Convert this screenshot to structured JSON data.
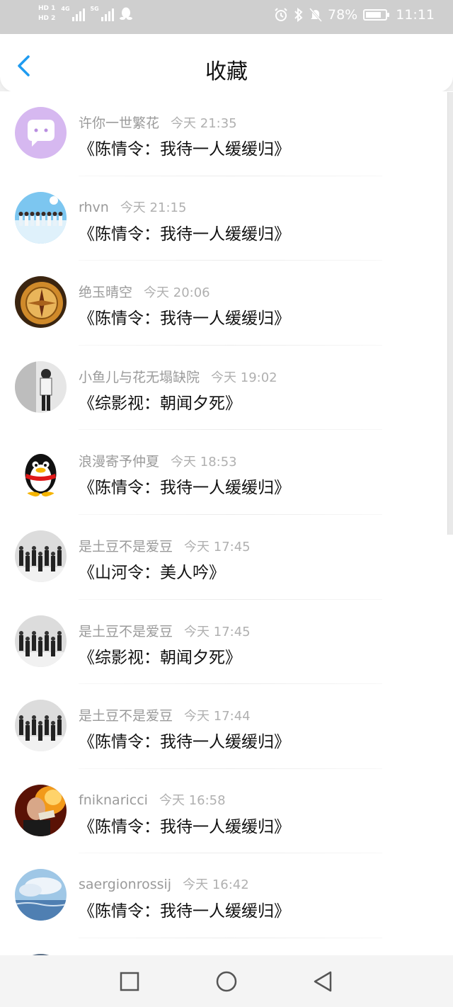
{
  "status_bar": {
    "hd1": "HD 1",
    "hd2": "HD 2",
    "net1": "4G",
    "net2": "5G",
    "battery_percent": "78%",
    "time": "11:11",
    "battery_level": 0.78
  },
  "header": {
    "title": "收藏",
    "accent": "#1e9bf0"
  },
  "favorites": [
    {
      "user": "许你一世繁花",
      "time": "今天 21:35",
      "title": "《陈情令：我待一人缓缓归》",
      "avatar": "chat-bubble"
    },
    {
      "user": "rhvn",
      "time": "今天 21:15",
      "title": "《陈情令：我待一人缓缓归》",
      "avatar": "group-sky"
    },
    {
      "user": "绝玉晴空",
      "time": "今天 20:06",
      "title": "《陈情令：我待一人缓缓归》",
      "avatar": "compass"
    },
    {
      "user": "小鱼儿与花无塌缺院",
      "time": "今天 19:02",
      "title": "《综影视：朝闻夕死》",
      "avatar": "person-bw"
    },
    {
      "user": "浪漫寄予仲夏",
      "time": "今天 18:53",
      "title": "《陈情令：我待一人缓缓归》",
      "avatar": "qq-penguin"
    },
    {
      "user": "是土豆不是爱豆",
      "time": "今天 17:45",
      "title": "《山河令：美人吟》",
      "avatar": "group-bw"
    },
    {
      "user": "是土豆不是爱豆",
      "time": "今天 17:45",
      "title": "《综影视：朝闻夕死》",
      "avatar": "group-bw"
    },
    {
      "user": "是土豆不是爱豆",
      "time": "今天 17:44",
      "title": "《陈情令：我待一人缓缓归》",
      "avatar": "group-bw"
    },
    {
      "user": "fniknaricci",
      "time": "今天 16:58",
      "title": "《陈情令：我待一人缓缓归》",
      "avatar": "fire-portrait"
    },
    {
      "user": "saergionrossij",
      "time": "今天 16:42",
      "title": "《陈情令：我待一人缓缓归》",
      "avatar": "sea-clouds"
    }
  ],
  "nav": {
    "recents_icon": "square-icon",
    "home_icon": "circle-icon",
    "back_icon": "triangle-back-icon"
  }
}
